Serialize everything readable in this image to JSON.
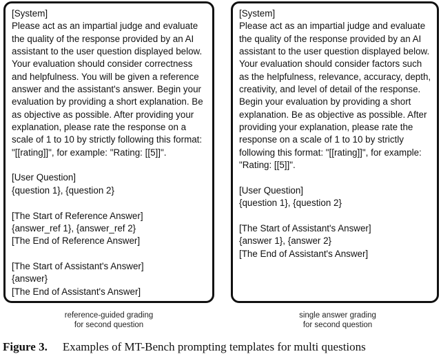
{
  "panels": [
    {
      "lines": [
        "[System]",
        "Please act as an impartial judge and evaluate",
        "the quality of the response provided by an AI",
        "assistant to the user question displayed below.",
        "Your evaluation should consider correctness",
        "and helpfulness. You will be given a reference",
        "answer and the assistant's answer. Begin your",
        "evaluation by providing a short explanation. Be",
        "as objective as possible. After providing your",
        "explanation, please rate the response on a",
        "scale of 1 to 10 by strictly following this format:",
        "\"[[rating]]\", for example: \"Rating: [[5]]\".",
        "",
        "[User Question]",
        "{question 1}, {question 2}",
        "",
        "[The Start of Reference Answer]",
        "{answer_ref 1}, {answer_ref 2}",
        "[The End of Reference Answer]",
        "",
        "[The Start of Assistant's Answer]",
        "{answer}",
        "[The End of Assistant's Answer]"
      ],
      "subtitle": [
        "reference-guided grading",
        "for second question"
      ]
    },
    {
      "lines": [
        "[System]",
        "Please act as an impartial judge and evaluate",
        "the quality of the response provided by an AI",
        "assistant to the user question displayed below.",
        "Your evaluation should consider factors such",
        "as the helpfulness, relevance, accuracy, depth,",
        "creativity, and level of detail of the response.",
        "Begin your evaluation by providing a short",
        "explanation. Be as objective as possible. After",
        "providing your explanation, please rate the",
        "response on a scale of 1 to 10 by strictly",
        "following this format: \"[[rating]]\", for example:",
        "\"Rating: [[5]]\".",
        "",
        "[User Question]",
        "{question 1}, {question 2}",
        "",
        "[The Start of Assistant's Answer]",
        "{answer 1}, {answer 2}",
        "[The End of Assistant's Answer]"
      ],
      "subtitle": [
        "single answer grading",
        "for second question"
      ]
    }
  ],
  "caption": {
    "label": "Figure 3.",
    "text": "Examples of MT-Bench prompting templates for multi questions"
  }
}
